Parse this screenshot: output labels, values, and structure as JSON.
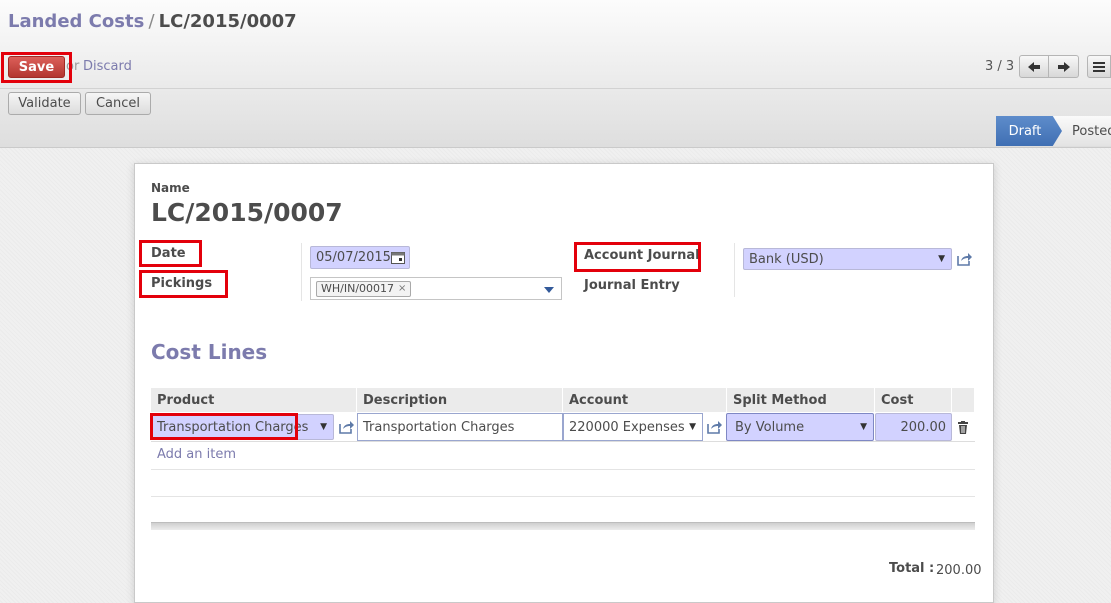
{
  "breadcrumb": {
    "parent": "Landed Costs",
    "separator": "/",
    "current": "LC/2015/0007"
  },
  "actions": {
    "save": "Save",
    "or": "or",
    "discard": "Discard",
    "validate": "Validate",
    "cancel": "Cancel"
  },
  "pager": {
    "position": "3 / 3"
  },
  "status": {
    "steps": [
      "Draft",
      "Posted"
    ],
    "active": "Draft"
  },
  "form": {
    "name_label": "Name",
    "name": "LC/2015/0007",
    "date_label": "Date",
    "date": "05/07/2015",
    "pickings_label": "Pickings",
    "pickings_tag": "WH/IN/00017",
    "account_journal_label": "Account Journal",
    "account_journal": "Bank (USD)",
    "journal_entry_label": "Journal Entry"
  },
  "cost_lines": {
    "title": "Cost Lines",
    "columns": [
      "Product",
      "Description",
      "Account",
      "Split Method",
      "Cost"
    ],
    "rows": [
      {
        "product": "Transportation Charges",
        "description": "Transportation Charges",
        "account": "220000 Expenses",
        "split_method": "By Volume",
        "cost": "200.00"
      }
    ],
    "add_item": "Add an item",
    "total_label": "Total :",
    "total": "200.00"
  },
  "icons": {
    "calendar": "calendar-icon",
    "external_link": "external-link-icon",
    "trash": "trash-icon",
    "prev": "arrow-left-icon",
    "next": "arrow-right-icon",
    "menu": "hamburger-icon"
  },
  "colors": {
    "accent": "#7c7bad",
    "save_button": "#c43f39",
    "status_active": "#4a7abe",
    "highlight_box": "#e3000b",
    "required_field": "#d2d2ff"
  }
}
